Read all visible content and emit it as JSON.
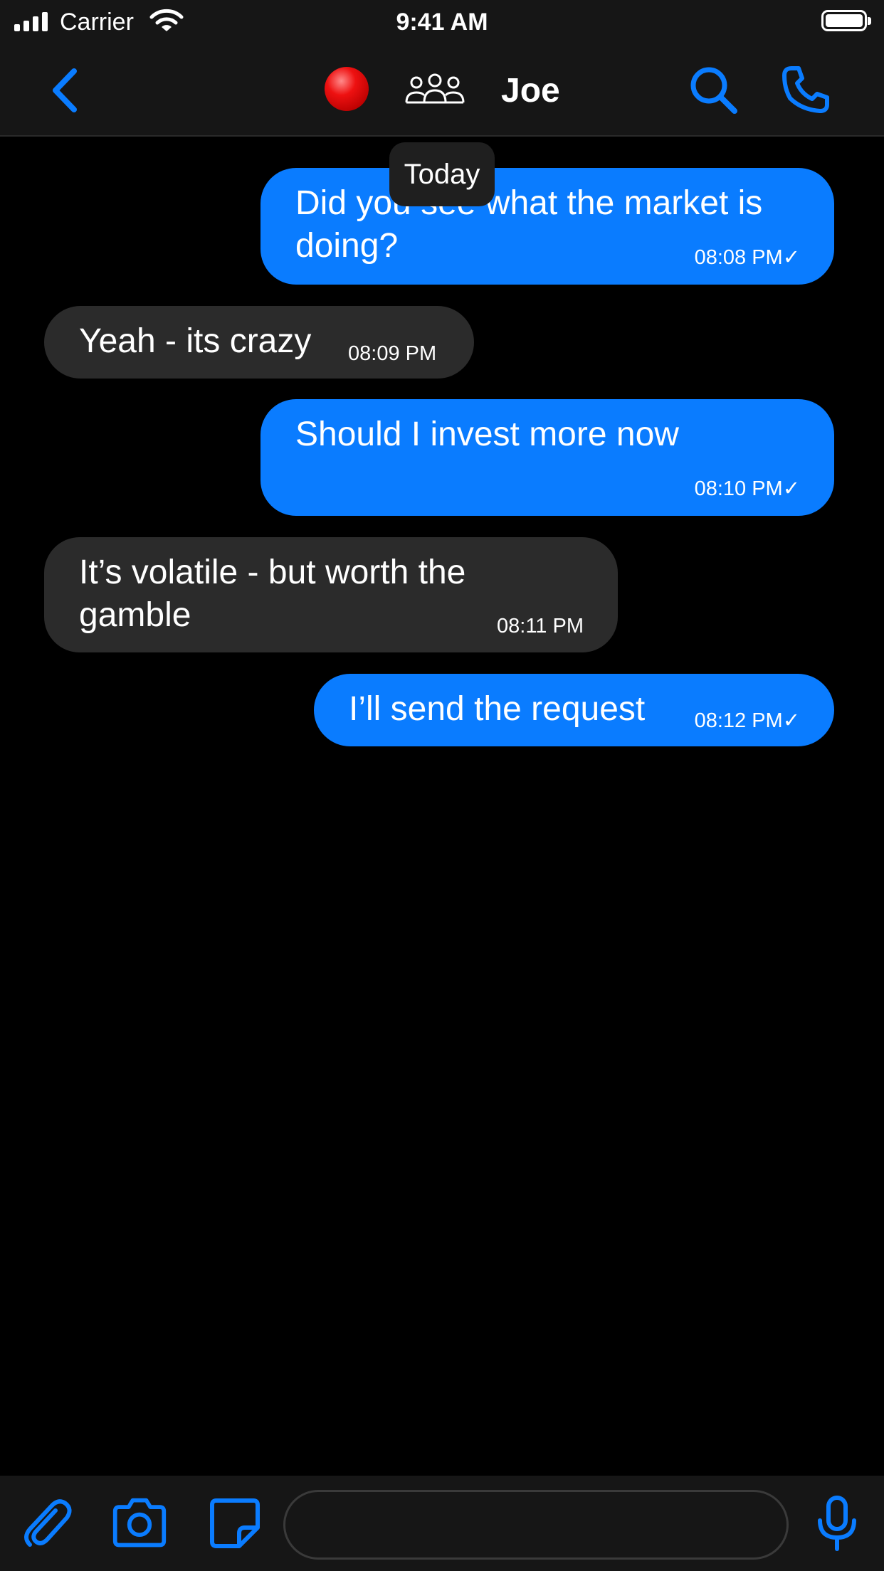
{
  "status_bar": {
    "carrier": "Carrier",
    "time": "9:41 AM",
    "icons": [
      "signal-icon",
      "wifi-icon",
      "battery-icon"
    ]
  },
  "header": {
    "contact_name": "Joe",
    "icons": [
      "chevron-left-icon",
      "status-dot-icon",
      "group-icon",
      "search-icon",
      "phone-icon"
    ]
  },
  "conversation": {
    "date_label": "Today",
    "messages": [
      {
        "direction": "outgoing",
        "lines": [
          "Did you see what the market is",
          "doing?"
        ],
        "time": "08:08 PM✓"
      },
      {
        "direction": "incoming",
        "lines": [
          "Yeah - its crazy"
        ],
        "time": "08:09 PM"
      },
      {
        "direction": "outgoing",
        "lines": [
          "Should I invest more now"
        ],
        "time": "08:10 PM✓"
      },
      {
        "direction": "incoming",
        "lines": [
          "It’s volatile - but worth the",
          "gamble"
        ],
        "time": "08:11 PM"
      },
      {
        "direction": "outgoing",
        "lines": [
          "I’ll send the request"
        ],
        "time": "08:12 PM✓"
      }
    ]
  },
  "composer": {
    "placeholder": "",
    "icons": [
      "paperclip-icon",
      "camera-icon",
      "sticker-icon",
      "microphone-icon"
    ]
  },
  "colors": {
    "accent": "#0a7cff",
    "incoming_bubble": "#2b2b2b",
    "bar_background": "#161616",
    "status_dot": "#e01010"
  }
}
